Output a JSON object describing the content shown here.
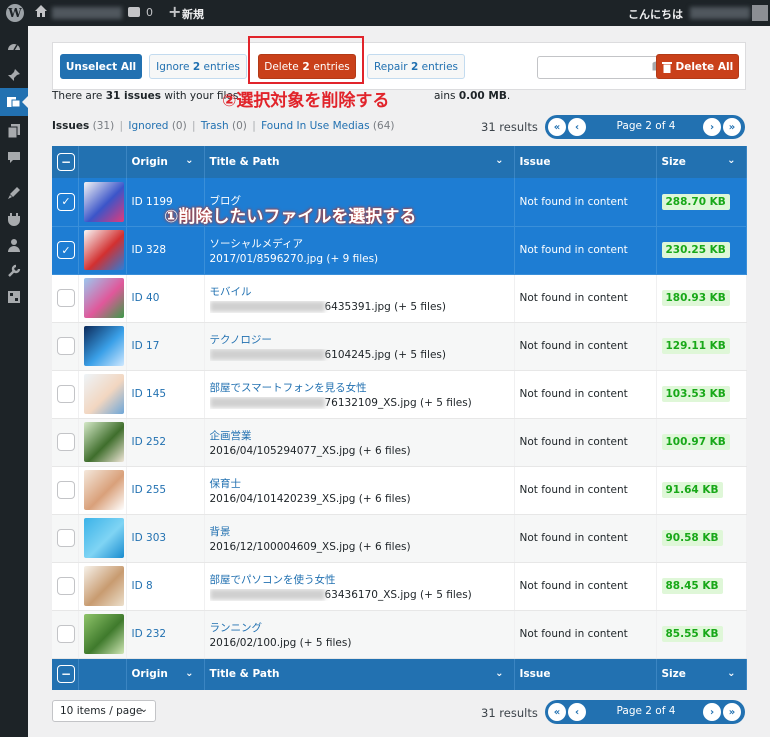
{
  "adminbar": {
    "comment_count": "0",
    "new_plus": "+",
    "new_label": "新規",
    "greeting": "こんにちは"
  },
  "sidebar": {
    "icons": [
      "dashboard-icon",
      "pin-icon",
      "media-cleaner-icon",
      "pages-icon",
      "comments-icon",
      "appearance-icon",
      "plugins-icon",
      "users-icon",
      "tools-icon",
      "settings-icon"
    ]
  },
  "toolbar": {
    "unselect_all": "Unselect All",
    "ignore_label": "Ignore",
    "ignore_count": "2",
    "ignore_suffix": "entries",
    "delete_label": "Delete",
    "delete_count": "2",
    "delete_suffix": "entries",
    "repair_label": "Repair",
    "repair_count": "2",
    "repair_suffix": "entries",
    "search_placeholder": "",
    "delete_all": "Delete All"
  },
  "annotations": {
    "step1": "①削除したいファイルを選択する",
    "step2": "②選択対象を削除する"
  },
  "summary": {
    "prefix": "There are",
    "count": "31 issues",
    "middle": "with your files",
    "suffix_pre": "ains",
    "size": "0.00 MB",
    "suffix_post": "."
  },
  "filters": {
    "issues_label": "Issues",
    "issues_count": "(31)",
    "ignored_label": "Ignored",
    "ignored_count": "(0)",
    "trash_label": "Trash",
    "trash_count": "(0)",
    "inuse_label": "Found In Use Medias",
    "inuse_count": "(64)",
    "separator": "|"
  },
  "pagination": {
    "results": "31 results",
    "page_label": "Page 2 of 4",
    "first": "«",
    "prev": "‹",
    "next": "›",
    "last": "»"
  },
  "table": {
    "columns": {
      "origin": "Origin",
      "title_path": "Title & Path",
      "issue": "Issue",
      "size": "Size"
    },
    "rows": [
      {
        "id": "ID 1199",
        "title": "ブログ",
        "path": "",
        "issue": "Not found in content",
        "size": "288.70 KB",
        "selected": true,
        "thumb": [
          "#f5f5f5",
          "#3b55c9",
          "#e23a7a"
        ]
      },
      {
        "id": "ID 328",
        "title": "ソーシャルメディア",
        "path": "2017/01/8596270.jpg (+ 9 files)",
        "issue": "Not found in content",
        "size": "230.25 KB",
        "selected": true,
        "thumb": [
          "#f8f8f8",
          "#d23030",
          "#2e7cd6"
        ]
      },
      {
        "id": "ID 40",
        "title": "モバイル",
        "path": "6435391.jpg (+ 5 files)",
        "blur": true,
        "issue": "Not found in content",
        "size": "180.93 KB",
        "selected": false,
        "thumb": [
          "#9cc8f0",
          "#e0589a",
          "#3c9a48"
        ]
      },
      {
        "id": "ID 17",
        "title": "テクノロジー",
        "path": "6104245.jpg (+ 5 files)",
        "blur": true,
        "issue": "Not found in content",
        "size": "129.11 KB",
        "selected": false,
        "thumb": [
          "#0c2a5a",
          "#3aa0e8",
          "#cfe8ff"
        ]
      },
      {
        "id": "ID 145",
        "title": "部屋でスマートフォンを見る女性",
        "path": "76132109_XS.jpg (+ 5 files)",
        "blur": true,
        "issue": "Not found in content",
        "size": "103.53 KB",
        "selected": false,
        "thumb": [
          "#eef4f8",
          "#f2d6c0",
          "#6da6d8"
        ]
      },
      {
        "id": "ID 252",
        "title": "企画営業",
        "path": "2016/04/105294077_XS.jpg (+ 6 files)",
        "issue": "Not found in content",
        "size": "100.97 KB",
        "selected": false,
        "thumb": [
          "#d5e9c8",
          "#3f6e2c",
          "#f0e6d8"
        ]
      },
      {
        "id": "ID 255",
        "title": "保育士",
        "path": "2016/04/101420239_XS.jpg (+ 6 files)",
        "issue": "Not found in content",
        "size": "91.64 KB",
        "selected": false,
        "thumb": [
          "#f4e8dc",
          "#d9a07a",
          "#ffffff"
        ]
      },
      {
        "id": "ID 303",
        "title": "背景",
        "path": "2016/12/100004609_XS.jpg (+ 6 files)",
        "issue": "Not found in content",
        "size": "90.58 KB",
        "selected": false,
        "thumb": [
          "#3bb2e8",
          "#7fd4f4",
          "#1a8ccf"
        ]
      },
      {
        "id": "ID 8",
        "title": "部屋でパソコンを使う女性",
        "path": "63436170_XS.jpg (+ 5 files)",
        "blur": true,
        "issue": "Not found in content",
        "size": "88.45 KB",
        "selected": false,
        "thumb": [
          "#f6f2ea",
          "#c89b70",
          "#ece0cc"
        ]
      },
      {
        "id": "ID 232",
        "title": "ランニング",
        "path": "2016/02/100.jpg (+ 5 files)",
        "issue": "Not found in content",
        "size": "85.55 KB",
        "selected": false,
        "thumb": [
          "#8fc46a",
          "#3f7a2c",
          "#cfe6b5"
        ]
      }
    ]
  },
  "footer": {
    "per_page": "10 items / page",
    "results": "31 results",
    "page_label": "Page 2 of 4"
  },
  "colors": {
    "accent": "#2271b1",
    "danger": "#c9401a",
    "annotation": "#e1242b",
    "size_green": "#18a818"
  }
}
